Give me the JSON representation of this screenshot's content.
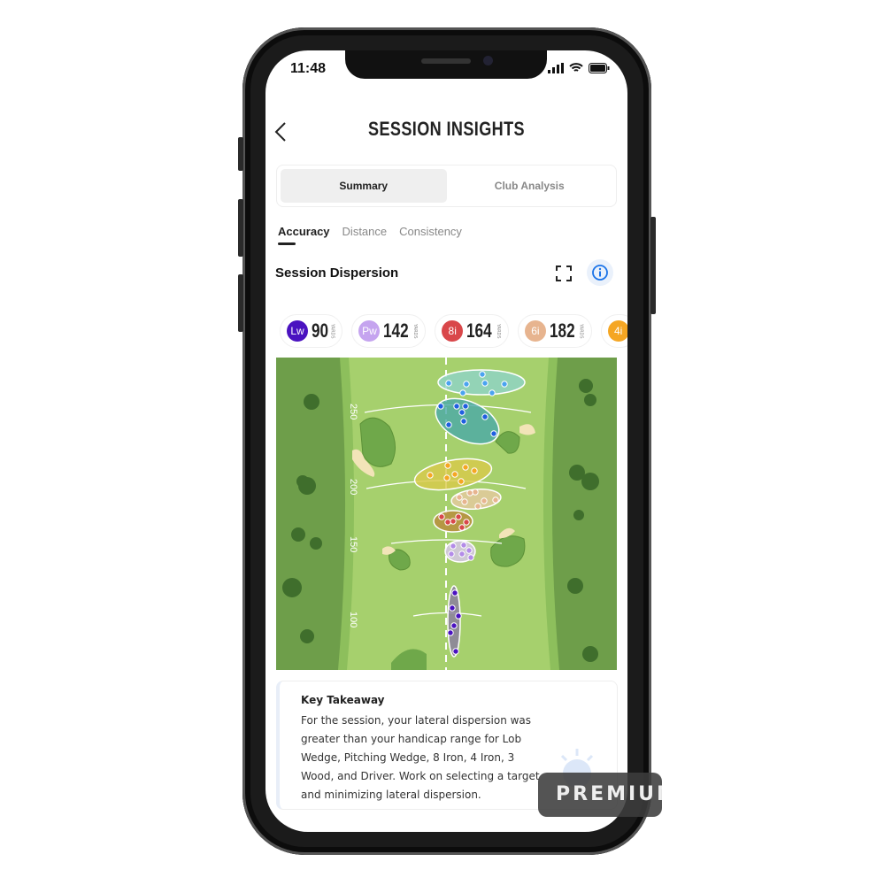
{
  "status_bar": {
    "time": "11:48"
  },
  "header": {
    "title": "SESSION INSIGHTS"
  },
  "segments": [
    {
      "label": "Summary",
      "active": true
    },
    {
      "label": "Club Analysis",
      "active": false
    }
  ],
  "tabs": [
    {
      "label": "Accuracy",
      "active": true
    },
    {
      "label": "Distance"
    },
    {
      "label": "Consistency"
    }
  ],
  "section": {
    "title": "Session Dispersion"
  },
  "clubs": [
    {
      "code": "Lw",
      "yards": "90",
      "unit": "YARDS",
      "color": "#4a12c0"
    },
    {
      "code": "Pw",
      "yards": "142",
      "unit": "YARDS",
      "color": "#c5a4ef"
    },
    {
      "code": "8i",
      "yards": "164",
      "unit": "YARDS",
      "color": "#d9474a"
    },
    {
      "code": "6i",
      "yards": "182",
      "unit": "YARDS",
      "color": "#e7b48f"
    },
    {
      "code": "4i",
      "yards": "",
      "unit": "",
      "color": "#f5a623"
    }
  ],
  "map": {
    "distance_labels": [
      "250",
      "200",
      "150",
      "100"
    ]
  },
  "takeaway": {
    "title": "Key Takeaway",
    "text": "For the session, your lateral dispersion was greater than your handicap range for Lob Wedge, Pitching Wedge, 8 Iron, 4 Iron, 3 Wood, and Driver. Work on selecting a target and minimizing lateral dispersion."
  },
  "watermark": "PREMIUM"
}
